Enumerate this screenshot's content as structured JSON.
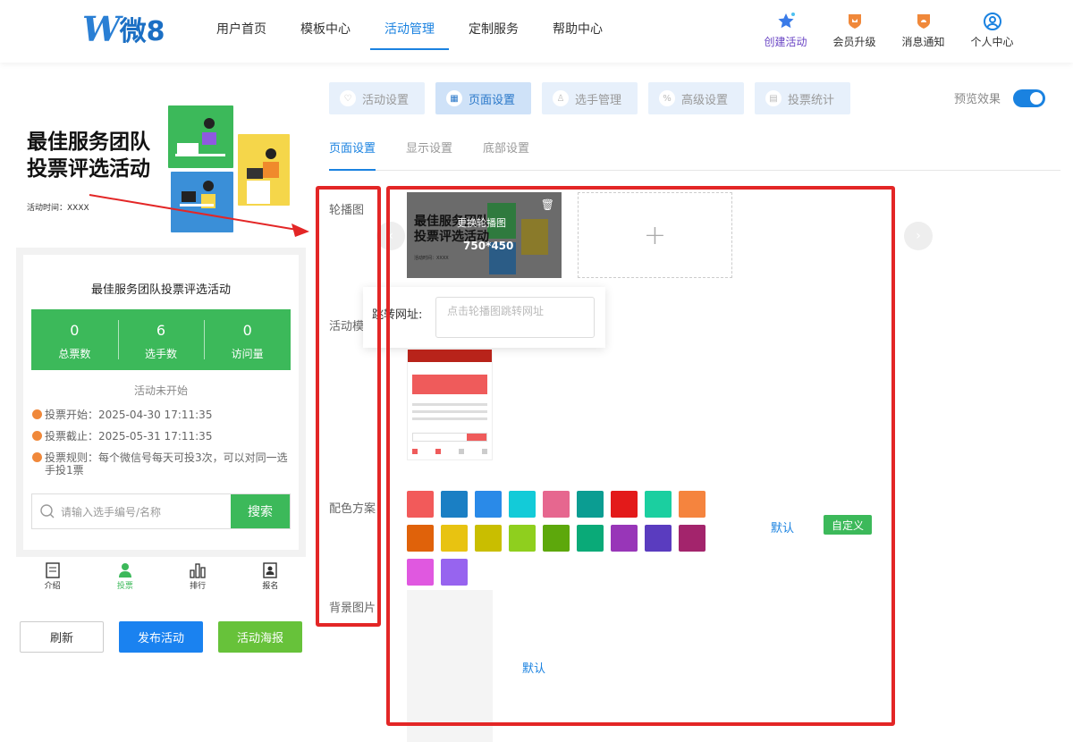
{
  "logo": {
    "mark": "W",
    "text": "微8"
  },
  "nav": [
    {
      "label": "用户首页",
      "active": false
    },
    {
      "label": "模板中心",
      "active": false
    },
    {
      "label": "活动管理",
      "active": true
    },
    {
      "label": "定制服务",
      "active": false
    },
    {
      "label": "帮助中心",
      "active": false
    }
  ],
  "header_actions": [
    "创建活动",
    "会员升级",
    "消息通知",
    "个人中心"
  ],
  "preview": {
    "banner_title_line1": "最佳服务团队",
    "banner_title_line2": "投票评选活动",
    "banner_time": "活动时间：XXXX",
    "card_title": "最佳服务团队投票评选活动",
    "stats": [
      {
        "value": "0",
        "label": "总票数"
      },
      {
        "value": "6",
        "label": "选手数"
      },
      {
        "value": "0",
        "label": "访问量"
      }
    ],
    "status": "活动未开始",
    "info": [
      "投票开始：2025-04-30 17:11:35",
      "投票截止：2025-05-31 17:11:35",
      "投票规则：每个微信号每天可投3次，可以对同一选手投1票"
    ],
    "search_placeholder": "请输入选手编号/名称",
    "search_button": "搜索",
    "tabs": [
      "介绍",
      "投票",
      "排行",
      "报名"
    ],
    "active_tab": 1
  },
  "actions": [
    "刷新",
    "发布活动",
    "活动海报"
  ],
  "steps": [
    "活动设置",
    "页面设置",
    "选手管理",
    "高级设置",
    "投票统计"
  ],
  "active_step": 1,
  "preview_effect": "预览效果",
  "subtabs": [
    "页面设置",
    "显示设置",
    "底部设置"
  ],
  "labels": [
    "轮播图",
    "活动模",
    "配色方案",
    "背景图片"
  ],
  "carousel": {
    "title_line1": "最佳服务团队",
    "title_line2": "投票评选活动",
    "overlay_text": "更换轮播图",
    "size": "750*450",
    "add": "+",
    "time": "活动时间：XXXX"
  },
  "link_label": "跳转网址:",
  "link_placeholder": "点击轮播图跳转网址",
  "colors": [
    "#f25a5a",
    "#1a7fc4",
    "#2a8ae8",
    "#13cbd8",
    "#e6678f",
    "#0b9d92",
    "#e31a1a",
    "#1bcfa0",
    "#f5843e",
    "#e0620a",
    "#e8c311",
    "#c9be00",
    "#8fcf1e",
    "#5da80c",
    "#0aaa78",
    "#9836b8",
    "#5a3cbf",
    "#a3246c",
    "#e058e0",
    "#9764ef"
  ],
  "color_default": "默认",
  "color_custom": "自定义",
  "bg_default": "默认"
}
